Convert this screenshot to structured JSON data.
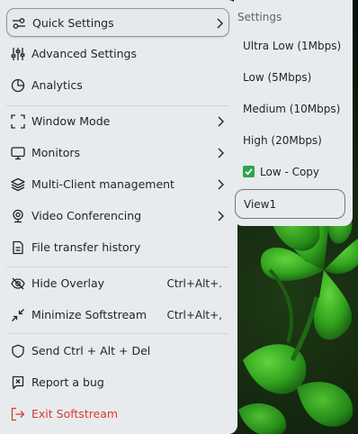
{
  "menu": {
    "items": [
      {
        "label": "Quick Settings",
        "icon": "sliders-toggle-icon"
      },
      {
        "label": "Advanced Settings",
        "icon": "equalizer-icon"
      },
      {
        "label": "Analytics",
        "icon": "pie-chart-icon"
      },
      {
        "label": "Window Mode",
        "icon": "fullscreen-corners-icon"
      },
      {
        "label": "Monitors",
        "icon": "monitor-icon"
      },
      {
        "label": "Multi-Client management",
        "icon": "layers-icon"
      },
      {
        "label": "Video Conferencing",
        "icon": "webcam-icon"
      },
      {
        "label": "File transfer history",
        "icon": "document-icon"
      },
      {
        "label": "Hide Overlay",
        "shortcut": "Ctrl+Alt+.",
        "icon": "eye-off-icon"
      },
      {
        "label": "Minimize Softstream",
        "shortcut": "Ctrl+Alt+,",
        "icon": "minimize-arrows-icon"
      },
      {
        "label": "Send Ctrl + Alt + Del",
        "icon": "shield-icon"
      },
      {
        "label": "Report a bug",
        "icon": "bug-report-icon"
      },
      {
        "label": "Exit Softstream",
        "icon": "exit-icon"
      }
    ]
  },
  "submenu": {
    "header": "Settings",
    "items": [
      {
        "label": "Ultra Low (1Mbps)"
      },
      {
        "label": "Low (5Mbps)"
      },
      {
        "label": "Medium (10Mbps)"
      },
      {
        "label": "High (20Mbps)"
      },
      {
        "label": "Low - Copy",
        "checked": true
      },
      {
        "label": "View1",
        "selected": true
      }
    ]
  },
  "colors": {
    "panel": "#e8ebed",
    "danger": "#d83a3a",
    "check": "#2da44e"
  }
}
